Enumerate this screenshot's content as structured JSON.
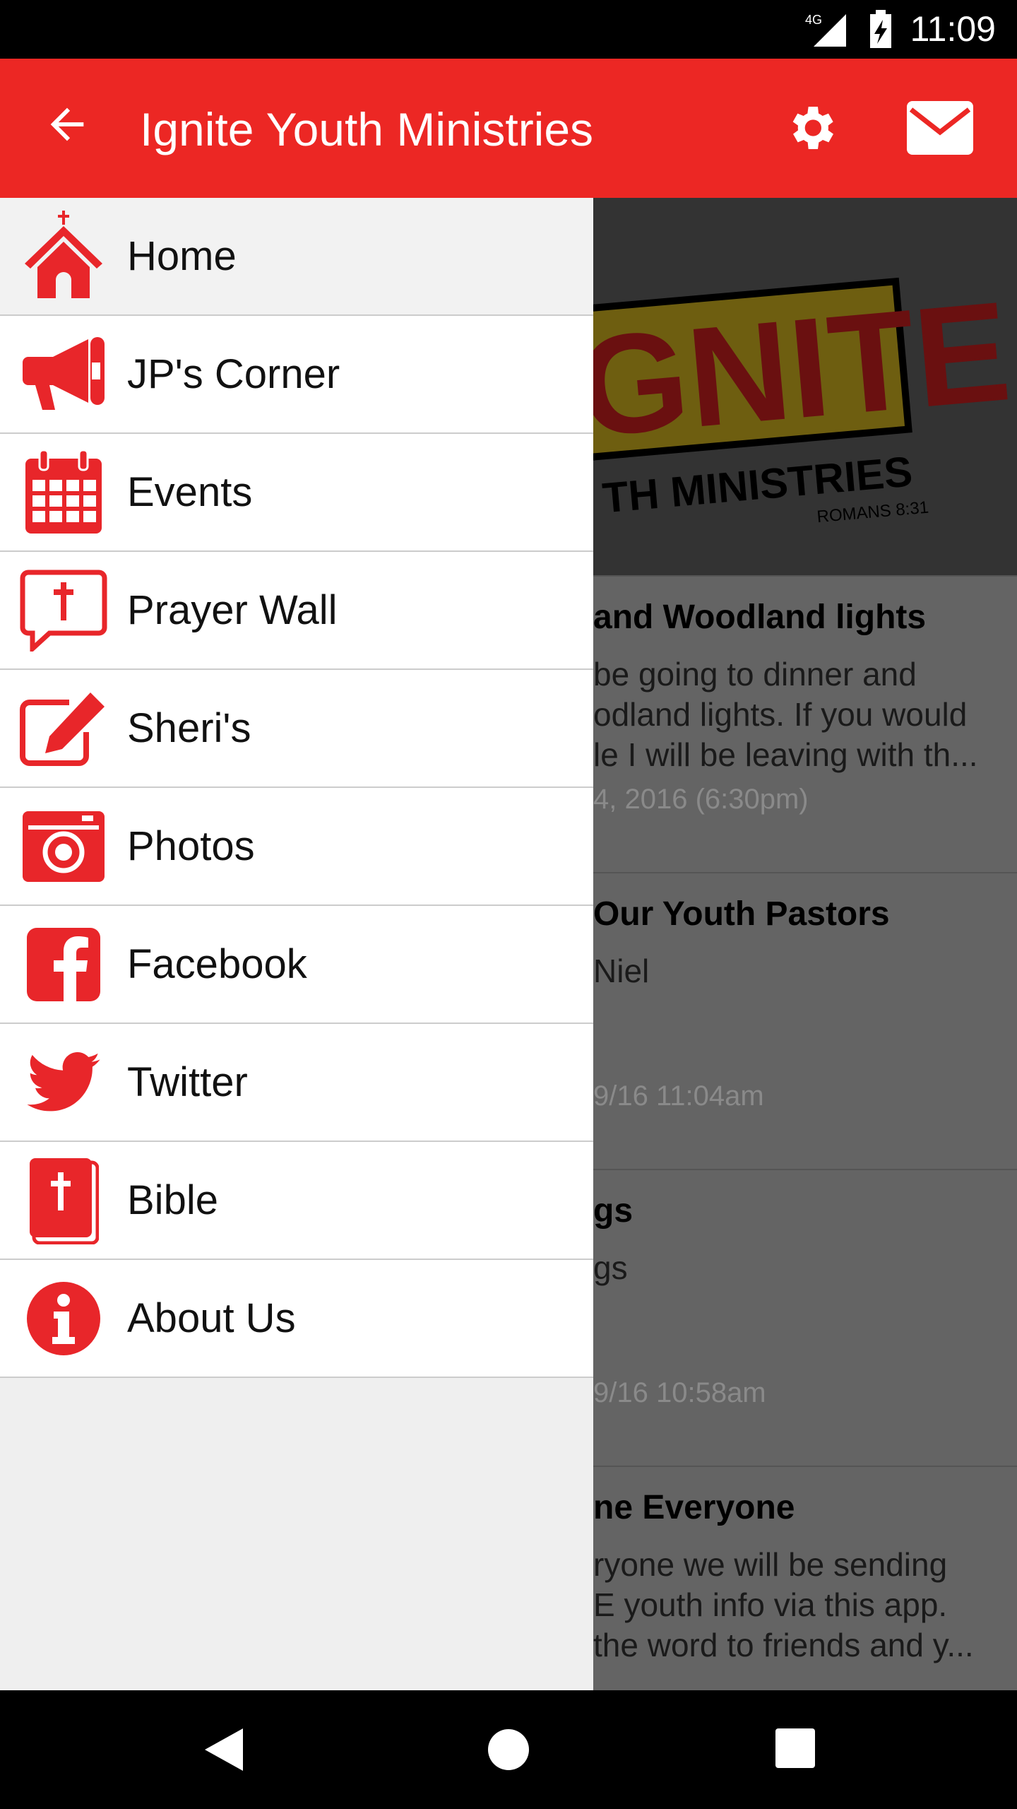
{
  "status_bar": {
    "network": "4G",
    "time": "11:09"
  },
  "toolbar": {
    "title": "Ignite Youth Ministries",
    "icons": [
      "back-arrow-icon",
      "gear-icon",
      "mail-icon"
    ]
  },
  "colors": {
    "accent": "#ec2724",
    "icon": "#e8262a"
  },
  "drawer": {
    "items": [
      {
        "label": "Home",
        "icon": "church-icon"
      },
      {
        "label": "JP's Corner",
        "icon": "megaphone-icon"
      },
      {
        "label": "Events",
        "icon": "calendar-icon"
      },
      {
        "label": "Prayer Wall",
        "icon": "prayer-bubble-icon"
      },
      {
        "label": "Sheri's",
        "icon": "edit-icon"
      },
      {
        "label": "Photos",
        "icon": "camera-icon"
      },
      {
        "label": "Facebook",
        "icon": "facebook-icon"
      },
      {
        "label": "Twitter",
        "icon": "twitter-icon"
      },
      {
        "label": "Bible",
        "icon": "bible-icon"
      },
      {
        "label": "About Us",
        "icon": "info-icon"
      }
    ]
  },
  "background": {
    "logo": {
      "text": "IGNITE",
      "sub": "YOUTH MINISTRIES",
      "verse": "ROMANS 8:31"
    },
    "posts": [
      {
        "title": "and Woodland lights",
        "body": [
          "be going to dinner and",
          "odland lights. If you would",
          "le I will be leaving with th..."
        ],
        "date": "4, 2016 (6:30pm)"
      },
      {
        "title": "Our Youth Pastors",
        "body": [
          "Niel",
          "",
          ""
        ],
        "date": "9/16 11:04am"
      },
      {
        "title": "gs",
        "body": [
          "gs",
          "",
          ""
        ],
        "date": "9/16 10:58am"
      },
      {
        "title": "ne Everyone",
        "body": [
          "ryone we will be sending",
          "E youth info via this app.",
          "the word to friends and y..."
        ],
        "date": ""
      }
    ]
  }
}
